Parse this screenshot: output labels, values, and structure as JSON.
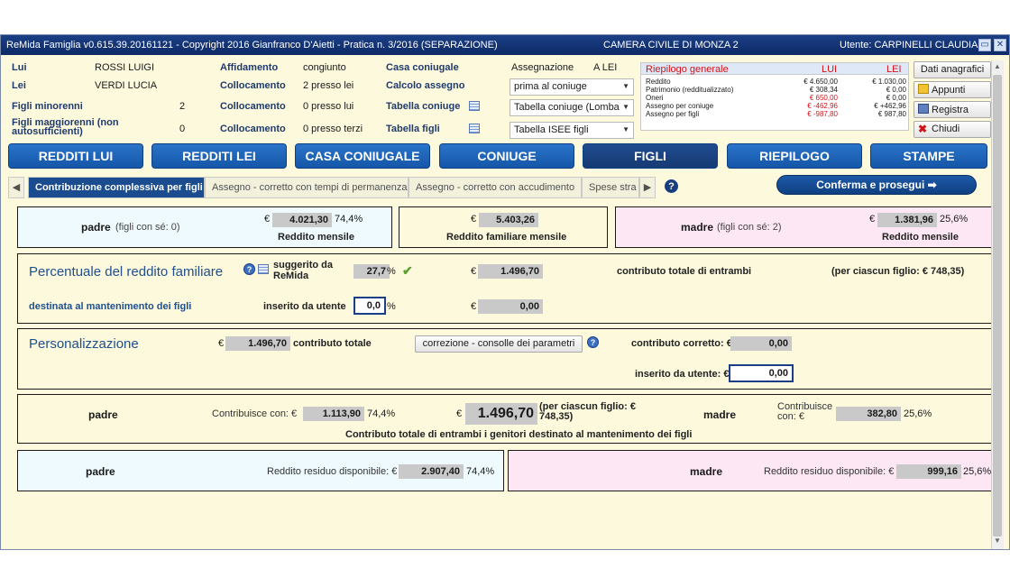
{
  "title_bar": {
    "app_title": "ReMida Famiglia v0.615.39.20161121 - Copyright 2016 Gianfranco D'Aietti - Pratica n. 3/2016 (SEPARAZIONE)",
    "court": "CAMERA CIVILE DI MONZA 2",
    "user": "Utente: CARPINELLI CLAUDIA"
  },
  "header": {
    "lui_label": "Lui",
    "lui_name": "ROSSI LUIGI",
    "lei_label": "Lei",
    "lei_name": "VERDI LUCIA",
    "figli_min_label": "Figli minorenni",
    "figli_min_value": "2",
    "figli_mag_label": "Figli maggiorenni (non autosufficienti)",
    "figli_mag_value": "0",
    "affidamento_label": "Affidamento",
    "affidamento_value": "congiunto",
    "collocamento_label": "Collocamento",
    "coll_1": "2 presso lei",
    "coll_2": "0 presso lui",
    "coll_3": "0 presso terzi",
    "casa_label": "Casa coniugale",
    "assegnazione_label": "Assegnazione",
    "assegnazione_value": "A LEI",
    "calcolo_label": "Calcolo assegno",
    "calcolo_value": "prima al coniuge",
    "tab_coniuge_label": "Tabella coniuge",
    "tab_coniuge_value": "Tabella coniuge (Lomba",
    "tab_figli_label": "Tabella figli",
    "tab_figli_value": "Tabella ISEE figli"
  },
  "riepilogo": {
    "title": "Riepilogo generale",
    "col_lui": "LUI",
    "col_lei": "LEI",
    "rows": [
      {
        "label": "Reddito",
        "lui": "€ 4.650,00",
        "lei": "€ 1.030,00"
      },
      {
        "label": "Patrimonio (redditualizzato)",
        "lui": "€ 308,34",
        "lei": "€ 0,00"
      },
      {
        "label": "Oneri",
        "lui": "€ 650,00",
        "lei": "€ 0,00"
      },
      {
        "label": "Assegno per coniuge",
        "lui": "€ -462,96",
        "lei": "€ +462,96"
      },
      {
        "label": "Assegno per figli",
        "lui": "€ -987,80",
        "lei": "€ 987,80"
      }
    ]
  },
  "side_buttons": {
    "dati": "Dati anagrafici",
    "appunti": "Appunti",
    "registra": "Registra",
    "chiudi": "Chiudi"
  },
  "nav": [
    "REDDITI LUI",
    "REDDITI LEI",
    "CASA CONIUGALE",
    "CONIUGE",
    "FIGLI",
    "RIEPILOGO",
    "STAMPE"
  ],
  "tabs": [
    "Contribuzione complessiva per figli",
    "Assegno - corretto con tempi di permanenza",
    "Assegno - corretto con accudimento",
    "Spese stra"
  ],
  "confirm_label": "Conferma e prosegui",
  "incomes": {
    "padre_label": "padre",
    "padre_note": "(figli con sé: 0)",
    "padre_value": "4.021,30",
    "padre_pct": "74,4%",
    "reddito_mensile": "Reddito mensile",
    "family_value": "5.403,26",
    "family_label": "Reddito familiare mensile",
    "madre_label": "madre",
    "madre_note": "(figli con sé: 2)",
    "madre_value": "1.381,96",
    "madre_pct": "25,6%",
    "euro": "€"
  },
  "percentuale": {
    "title": "Percentuale del reddito familiare",
    "suggerito_label": "suggerito da ReMida",
    "suggerito_value": "27,7",
    "pct_sign": "%",
    "contributo_value": "1.496,70",
    "contributo_label": "contributo totale di entrambi",
    "per_figlio": "(per ciascun figlio: € 748,35)",
    "destinata": "destinata al mantenimento dei figli",
    "inserito_label": "inserito da utente",
    "inserito_value": "0,0",
    "inserito_euro_value": "0,00"
  },
  "personalizzazione": {
    "title": "Personalizzazione",
    "contributo_value": "1.496,70",
    "contributo_label": "contributo totale",
    "correzione_button": "correzione - consolle dei parametri",
    "corretto_label": "contributo corretto: €",
    "corretto_value": "0,00",
    "inserito_label": "inserito da utente: €",
    "inserito_value": "0,00"
  },
  "contributi": {
    "padre": "padre",
    "contribuisce_label": "Contribuisce con: €",
    "padre_value": "1.113,90",
    "padre_pct": "74,4%",
    "total_value": "1.496,70",
    "per_figlio": "(per ciascun figlio: € 748,35)",
    "madre": "madre",
    "madre_contribuisce": "Contribuisce con: €",
    "madre_value": "382,80",
    "madre_pct": "25,6%",
    "caption": "Contributo totale di entrambi i genitori destinato al mantenimento dei figli"
  },
  "residuo": {
    "padre": "padre",
    "label": "Reddito residuo disponibile: €",
    "padre_value": "2.907,40",
    "padre_pct": "74,4%",
    "madre": "madre",
    "madre_value": "999,16",
    "madre_pct": "25,6%"
  }
}
